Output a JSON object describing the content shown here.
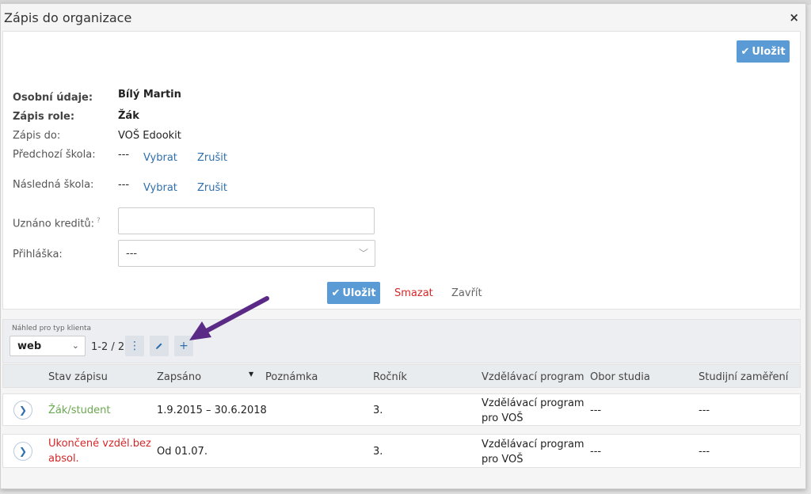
{
  "dialog": {
    "title": "Zápis do organizace",
    "close_label": "×"
  },
  "actions": {
    "save_label": "Uložit",
    "delete_label": "Smazat",
    "close_label": "Zavřít"
  },
  "form": {
    "personal_label": "Osobní údaje:",
    "personal_value": "Bílý Martin",
    "role_label": "Zápis role:",
    "role_value": "Žák",
    "enroll_to_label": "Zápis do:",
    "enroll_to_value": "VOŠ Edookit",
    "prev_school_label": "Předchozí škola:",
    "prev_school_value": "---",
    "next_school_label": "Následná škola:",
    "next_school_value": "---",
    "choose_label": "Vybrat",
    "cancel_label": "Zrušit",
    "credits_label": "Uznáno kreditů:",
    "credits_help": "?",
    "credits_value": "",
    "application_label": "Přihláška:",
    "application_value": "---"
  },
  "toolbar": {
    "client_type_label": "Náhled pro typ klienta",
    "client_type_value": "web",
    "pager_text": "1-2 / 2"
  },
  "table": {
    "columns": [
      "Stav zápisu",
      "Zapsáno",
      "Poznámka",
      "Ročník",
      "Vzdělávací program",
      "Obor studia",
      "Studijní zaměření"
    ],
    "rows": [
      {
        "status": "Žák/student",
        "enrolled": "1.9.2015 – 30.6.2018",
        "note": "",
        "year": "3.",
        "program_line1": "Vzdělávací program",
        "program_line2": "pro VOŠ",
        "field": "---",
        "specialization": "---"
      },
      {
        "status_line1": "Ukončené vzděl.bez",
        "status_line2": "absol.",
        "enrolled": "Od 01.07.",
        "note": "",
        "year": "3.",
        "program_line1": "Vzdělávací program",
        "program_line2": "pro VOŠ",
        "field": "---",
        "specialization": "---"
      }
    ]
  },
  "colors": {
    "primary": "#5b9bd5",
    "link": "#2f6fad",
    "danger": "#d62728",
    "success": "#6aa84f",
    "annotation_arrow": "#5b2a86"
  }
}
